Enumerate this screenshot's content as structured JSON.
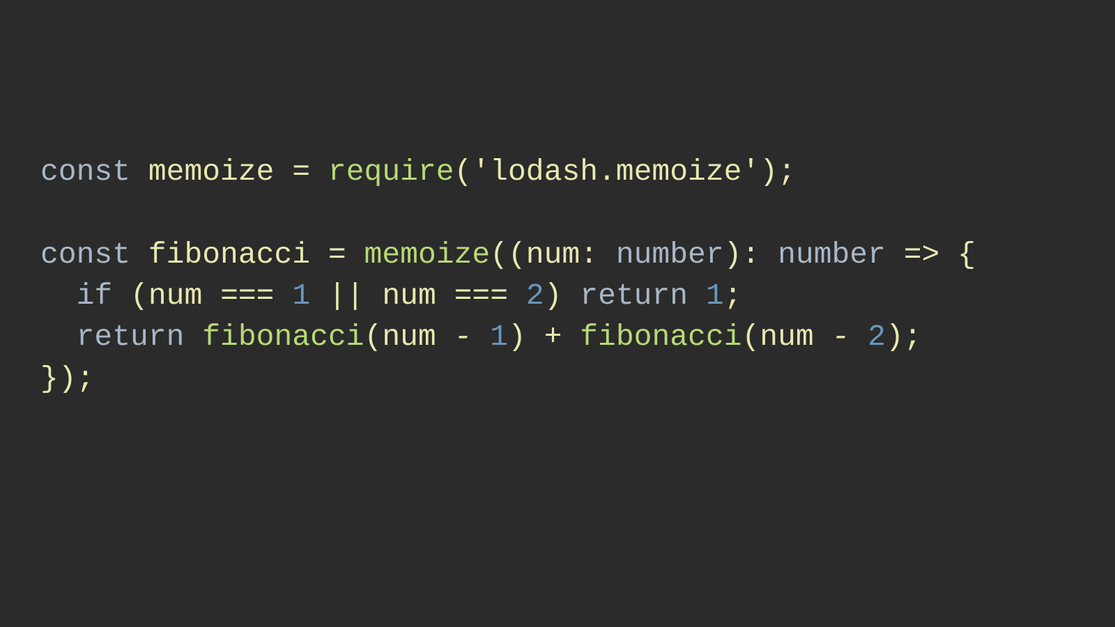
{
  "code": {
    "line1": {
      "kw_const": "const",
      "var_memoize": "memoize",
      "eq": "=",
      "fn_require": "require",
      "lp": "(",
      "str": "'lodash.memoize'",
      "rp": ")",
      "semi": ";"
    },
    "line2_blank": "",
    "line3": {
      "kw_const": "const",
      "var_fib": "fibonacci",
      "eq": "=",
      "fn_memoize": "memoize",
      "lp1": "((",
      "param": "num",
      "colon1": ":",
      "type1": "number",
      "rp1": ")",
      "colon2": ":",
      "type2": "number",
      "arrow": "=>",
      "lbrace": "{"
    },
    "line4": {
      "indent": "  ",
      "kw_if": "if",
      "lp": "(",
      "id1": "num",
      "eq1": "===",
      "n1": "1",
      "or": "||",
      "id2": "num",
      "eq2": "===",
      "n2": "2",
      "rp": ")",
      "kw_return": "return",
      "n3": "1",
      "semi": ";"
    },
    "line5": {
      "indent": "  ",
      "kw_return": "return",
      "fn1": "fibonacci",
      "lp1": "(",
      "id1": "num",
      "minus1": "-",
      "n1": "1",
      "rp1": ")",
      "plus": "+",
      "fn2": "fibonacci",
      "lp2": "(",
      "id2": "num",
      "minus2": "-",
      "n2": "2",
      "rp2": ")",
      "semi": ";"
    },
    "line6": {
      "rbrace": "}",
      "rp": ")",
      "semi": ";"
    }
  }
}
